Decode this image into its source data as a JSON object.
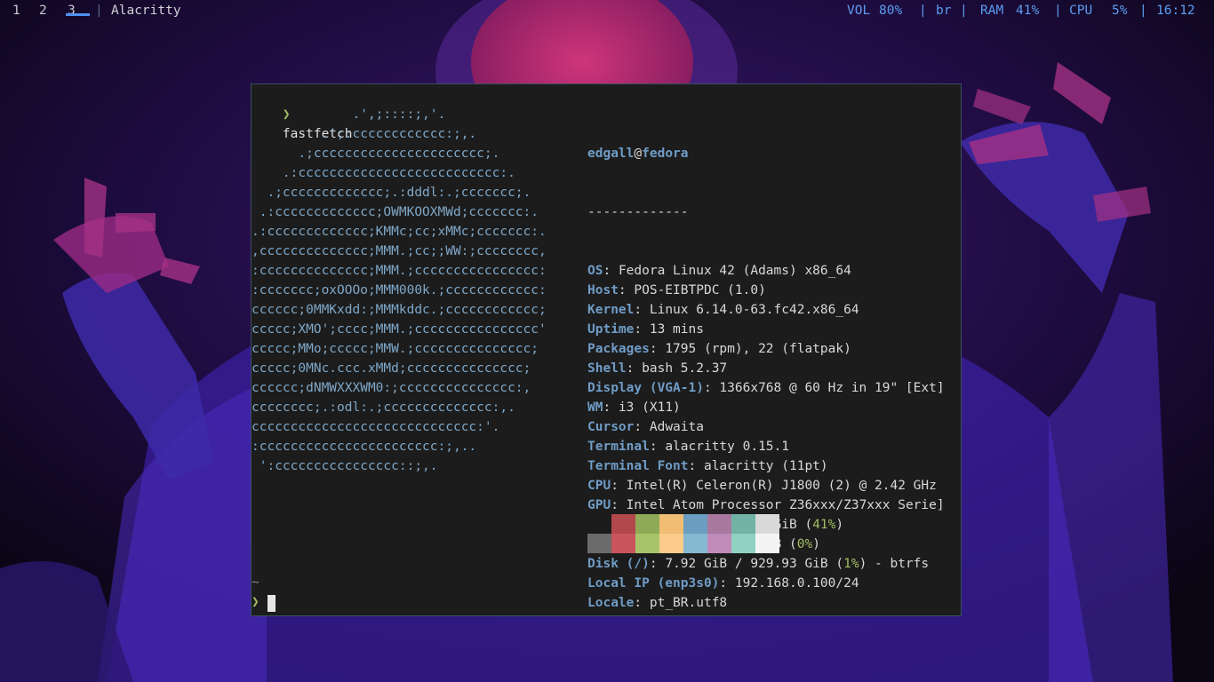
{
  "workspaces": [
    {
      "label": "1",
      "focused": false
    },
    {
      "label": "2",
      "focused": false
    },
    {
      "label": "3",
      "focused": true
    }
  ],
  "bar": {
    "separator": "|",
    "window_title": "Alacritty"
  },
  "status": {
    "vol_label": "VOL",
    "vol_value": "80%",
    "layout": "br",
    "ram_label": "RAM",
    "ram_value": "41%",
    "cpu_label": "CPU",
    "cpu_value": "5%",
    "time": "16:12",
    "separator": "|"
  },
  "terminal": {
    "prompt_symbol": "❯",
    "command": "fastfetch",
    "tilde": "~",
    "logo_lines": [
      "             .',;::::;,'.",
      "         .';:cccccccccccc:;,.",
      "      .;cccccccccccccccccccccc;.",
      "    .:cccccccccccccccccccccccccc:.",
      "  .;ccccccccccccc;.:dddl:.;ccccccc;.",
      " .:ccccccccccccc;OWMKOOXMWd;ccccccc:.",
      ".:ccccccccccccc;KMMc;cc;xMMc;ccccccc:.",
      ",cccccccccccccc;MMM.;cc;;WW:;cccccccc,",
      ":cccccccccccccc;MMM.;cccccccccccccccc:",
      ":ccccccc;oxOOOo;MMM000k.;cccccccccccc:",
      "cccccc;0MMKxdd:;MMMkddc.;cccccccccccc;",
      "ccccc;XMO';cccc;MMM.;cccccccccccccccc'",
      "ccccc;MMo;ccccc;MMW.;ccccccccccccccc;",
      "ccccc;0MNc.ccc.xMMd;ccccccccccccccc;",
      "cccccc;dNMWXXXWM0:;ccccccccccccccc:,",
      "cccccccc;.:odl:.;cccccccccccccc:,.",
      "ccccccccccccccccccccccccccccc:'.",
      ":ccccccccccccccccccccccc:;,..",
      " ':cccccccccccccccc::;,."
    ],
    "info": {
      "user": "edgall",
      "at": "@",
      "host": "fedora",
      "divider": "-------------",
      "rows": [
        {
          "key": "OS",
          "value": "Fedora Linux 42 (Adams) x86_64"
        },
        {
          "key": "Host",
          "value": "POS-EIBTPDC (1.0)"
        },
        {
          "key": "Kernel",
          "value": "Linux 6.14.0-63.fc42.x86_64"
        },
        {
          "key": "Uptime",
          "value": "13 mins"
        },
        {
          "key": "Packages",
          "value": "1795 (rpm), 22 (flatpak)"
        },
        {
          "key": "Shell",
          "value": "bash 5.2.37"
        },
        {
          "key": "Display (VGA-1)",
          "value": "1366x768 @ 60 Hz in 19\" [Ext]"
        },
        {
          "key": "WM",
          "value": "i3 (X11)"
        },
        {
          "key": "Cursor",
          "value": "Adwaita"
        },
        {
          "key": "Terminal",
          "value": "alacritty 0.15.1"
        },
        {
          "key": "Terminal Font",
          "value": "alacritty (11pt)"
        },
        {
          "key": "CPU",
          "value": "Intel(R) Celeron(R) J1800 (2) @ 2.42 GHz"
        },
        {
          "key": "GPU",
          "value": "Intel Atom Processor Z36xxx/Z37xxx Serie]"
        },
        {
          "key": "Memory",
          "value": "1.53 GiB / 3.70 GiB (",
          "pct": "41%",
          "tail": ")"
        },
        {
          "key": "Swap",
          "value": "1.50 MiB / 3.70 GiB (",
          "pct": "0%",
          "tail": ")"
        },
        {
          "key": "Disk (/)",
          "value": "7.92 GiB / 929.93 GiB (",
          "pct": "1%",
          "tail": ") - btrfs"
        },
        {
          "key": "Local IP (enp3s0)",
          "value": "192.168.0.100/24"
        },
        {
          "key": "Locale",
          "value": "pt_BR.utf8"
        }
      ]
    },
    "palette": {
      "normal": [
        "#1c1c1c",
        "#b3484c",
        "#8faa56",
        "#f0bd72",
        "#6a9dbf",
        "#a8789f",
        "#73b3a6",
        "#d9d9d9"
      ],
      "bright": [
        "#6b6b6b",
        "#c9545b",
        "#a8c46a",
        "#fbcc8a",
        "#85b8d1",
        "#c08bb8",
        "#8fd2c2",
        "#f4f4f4"
      ]
    }
  }
}
